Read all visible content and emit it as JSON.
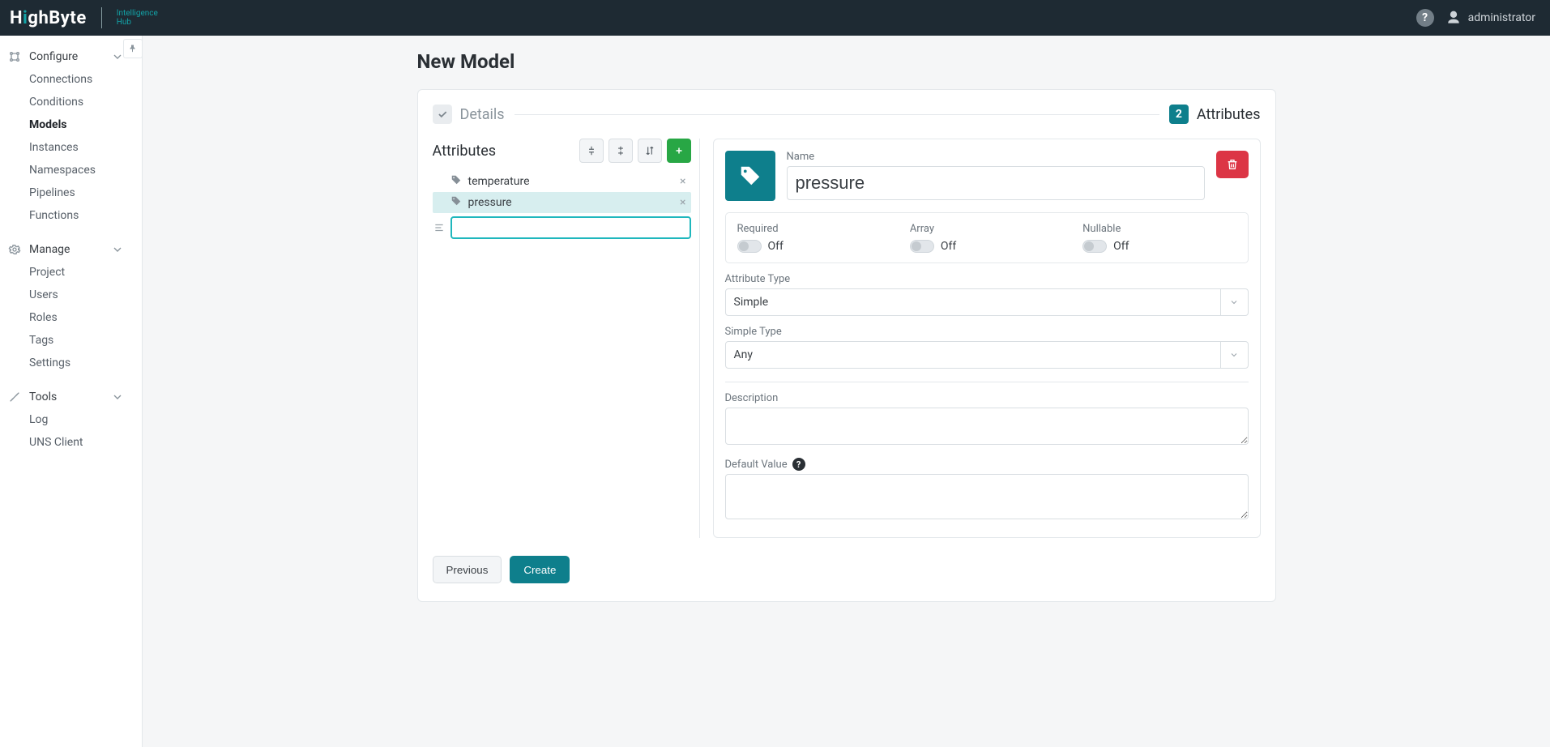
{
  "brand": {
    "word_a": "H",
    "word_b": "i",
    "word_c": "ghByte",
    "sub1": "Intelligence",
    "sub2": "Hub"
  },
  "user": {
    "name": "administrator"
  },
  "sidebar": {
    "pin_tooltip": "Pin",
    "sections": [
      {
        "title": "Configure",
        "items": [
          {
            "label": "Connections"
          },
          {
            "label": "Conditions"
          },
          {
            "label": "Models",
            "active": true
          },
          {
            "label": "Instances"
          },
          {
            "label": "Namespaces"
          },
          {
            "label": "Pipelines"
          },
          {
            "label": "Functions"
          }
        ]
      },
      {
        "title": "Manage",
        "items": [
          {
            "label": "Project"
          },
          {
            "label": "Users"
          },
          {
            "label": "Roles"
          },
          {
            "label": "Tags"
          },
          {
            "label": "Settings"
          }
        ]
      },
      {
        "title": "Tools",
        "items": [
          {
            "label": "Log"
          },
          {
            "label": "UNS Client"
          }
        ]
      }
    ]
  },
  "page": {
    "title": "New Model"
  },
  "wizard": {
    "step1": {
      "title": "Details"
    },
    "step2": {
      "num": "2",
      "title": "Attributes"
    }
  },
  "attributes": {
    "heading": "Attributes",
    "items": [
      {
        "label": "temperature",
        "selected": false
      },
      {
        "label": "pressure",
        "selected": true
      }
    ],
    "new_value": ""
  },
  "editor": {
    "name_label": "Name",
    "name_value": "pressure",
    "required": {
      "label": "Required",
      "state": "Off"
    },
    "array": {
      "label": "Array",
      "state": "Off"
    },
    "nullable": {
      "label": "Nullable",
      "state": "Off"
    },
    "attr_type": {
      "label": "Attribute Type",
      "value": "Simple"
    },
    "simple_type": {
      "label": "Simple Type",
      "value": "Any"
    },
    "description": {
      "label": "Description",
      "value": ""
    },
    "default_value": {
      "label": "Default Value",
      "value": ""
    }
  },
  "buttons": {
    "previous": "Previous",
    "create": "Create"
  }
}
